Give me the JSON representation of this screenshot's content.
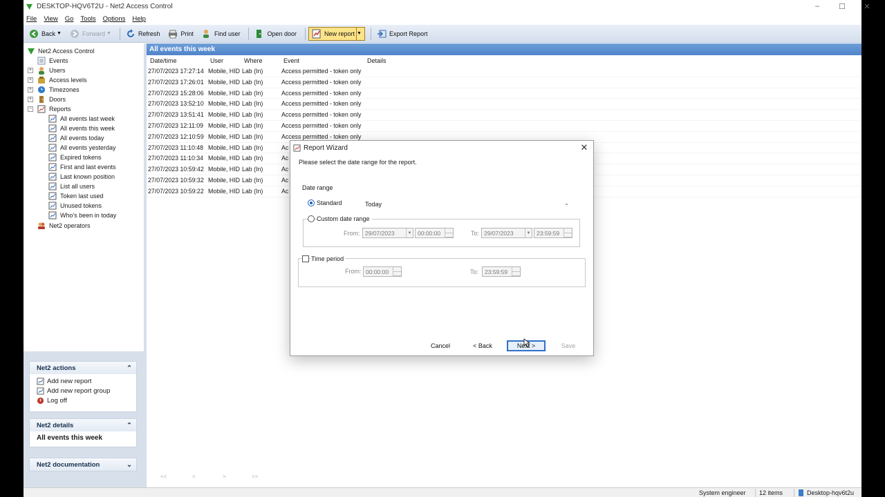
{
  "window": {
    "title": "DESKTOP-HQV6T2U - Net2 Access Control",
    "controls": [
      "–",
      "☐",
      "✕"
    ]
  },
  "menu": [
    "File",
    "View",
    "Go",
    "Tools",
    "Options",
    "Help"
  ],
  "toolbar": {
    "back": "Back",
    "forward": "Forward",
    "refresh": "Refresh",
    "print": "Print",
    "find_user": "Find user",
    "open_door": "Open door",
    "new_report": "New report",
    "export_report": "Export Report"
  },
  "tree": {
    "root": "Net2 Access Control",
    "events": "Events",
    "users": "Users",
    "access_levels": "Access levels",
    "timezones": "Timezones",
    "doors": "Doors",
    "reports": "Reports",
    "report_items": [
      "All events last week",
      "All events this week",
      "All events today",
      "All events yesterday",
      "Expired tokens",
      "First and last events",
      "Last known position",
      "List all users",
      "Token last used",
      "Unused tokens",
      "Who's been in today"
    ],
    "operators": "Net2 operators"
  },
  "side_groups": {
    "actions_title": "Net2 actions",
    "actions": [
      "Add new report",
      "Add new report group",
      "Log off"
    ],
    "details_title": "Net2 details",
    "details_value": "All events this week",
    "docs_title": "Net2 documentation"
  },
  "main": {
    "header": "All events this week",
    "columns": [
      "Date/time",
      "User",
      "Where",
      "Event",
      "Details"
    ],
    "rows": [
      [
        "27/07/2023  17:27:14",
        "Mobile, HID",
        "Lab (In)",
        "Access permitted - token only"
      ],
      [
        "27/07/2023  17:26:01",
        "Mobile, HID",
        "Lab (In)",
        "Access permitted - token only"
      ],
      [
        "27/07/2023  15:28:06",
        "Mobile, HID",
        "Lab (In)",
        "Access permitted - token only"
      ],
      [
        "27/07/2023  13:52:10",
        "Mobile, HID",
        "Lab (In)",
        "Access permitted - token only"
      ],
      [
        "27/07/2023  13:51:41",
        "Mobile, HID",
        "Lab (In)",
        "Access permitted - token only"
      ],
      [
        "27/07/2023  12:11:09",
        "Mobile, HID",
        "Lab (In)",
        "Access permitted - token only"
      ],
      [
        "27/07/2023  12:10:59",
        "Mobile, HID",
        "Lab (In)",
        "Access permitted - token only"
      ],
      [
        "27/07/2023  11:10:48",
        "Mobile, HID",
        "Lab (In)",
        "Ac"
      ],
      [
        "27/07/2023  11:10:34",
        "Mobile, HID",
        "Lab (In)",
        "Ac"
      ],
      [
        "27/07/2023  10:59:42",
        "Mobile, HID",
        "Lab (In)",
        "Ac"
      ],
      [
        "27/07/2023  10:59:32",
        "Mobile, HID",
        "Lab (In)",
        "Ac"
      ],
      [
        "27/07/2023  10:59:22",
        "Mobile, HID",
        "Lab (In)",
        "Ac"
      ]
    ],
    "pager": [
      "<<",
      "<",
      ">",
      ">>"
    ]
  },
  "status": {
    "role": "System engineer",
    "items": "12 items",
    "machine": "Desktop-hqv6t2u"
  },
  "dialog": {
    "title": "Report Wizard",
    "intro": "Please select the date range for the report.",
    "date_range_label": "Date range",
    "standard_label": "Standard",
    "standard_value": "Today",
    "custom_label": "Custom date range",
    "from_label": "From:",
    "to_label": "To:",
    "custom_from_date": "29/07/2023",
    "custom_from_time": "00:00:00",
    "custom_to_date": "29/07/2023",
    "custom_to_time": "23:59:59",
    "time_period_label": "Time period",
    "period_from": "00:00:00",
    "period_to": "23:59:59",
    "cancel": "Cancel",
    "back": "< Back",
    "next": "Next >",
    "save": "Save",
    "selected_option": "standard"
  },
  "colors": {
    "accent": "#4e84c9",
    "toolbar_active": "#fde38a",
    "panel": "#d7dfea"
  }
}
